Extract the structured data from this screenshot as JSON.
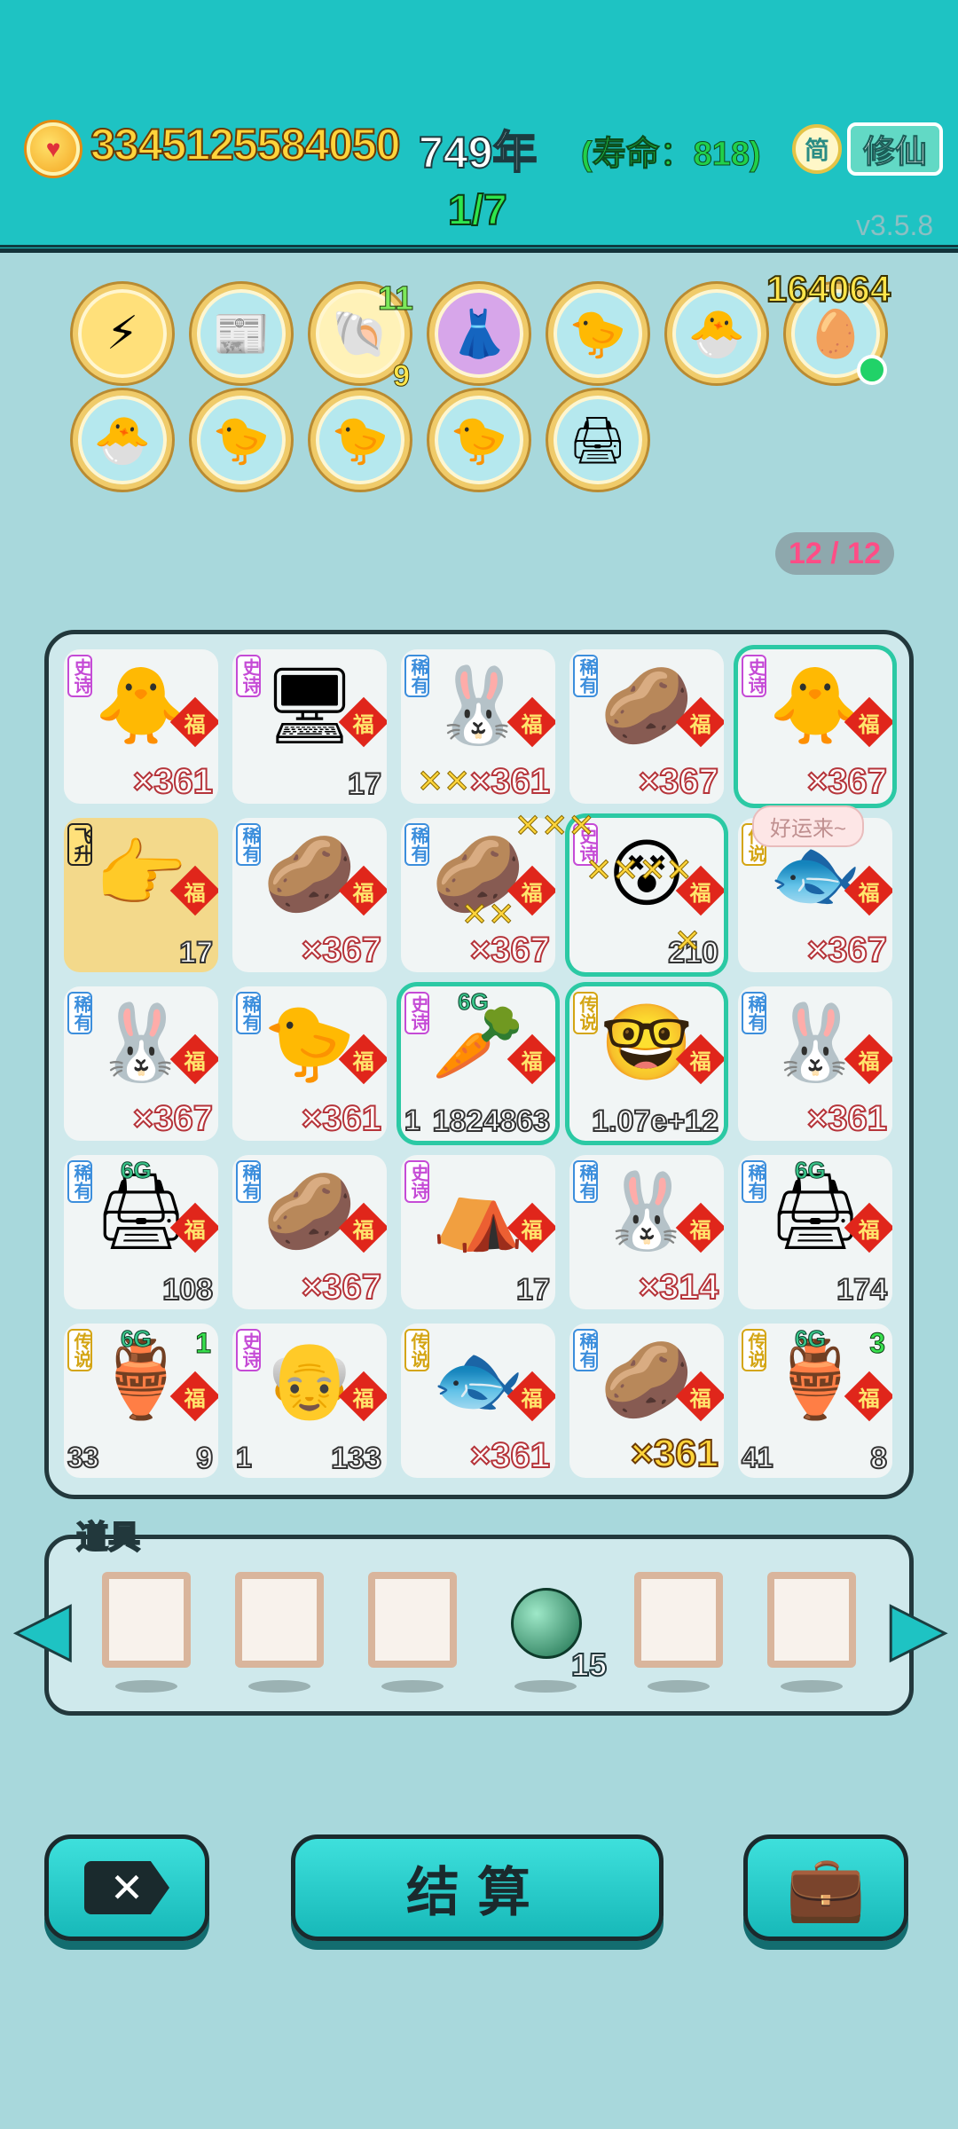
{
  "header": {
    "coin_icon": "heart-coin-icon",
    "coins": "3345125584050",
    "years": "749年",
    "lifespan": "(寿命：818)",
    "simp_label": "简",
    "xiuxian_label": "修仙",
    "stage": "1/7",
    "version": "v3.5.8"
  },
  "relics": {
    "row1": [
      {
        "icon": "lightning-icon",
        "glyph": "⚡"
      },
      {
        "icon": "time-magazine-icon",
        "glyph": "📰"
      },
      {
        "icon": "shell-icon",
        "glyph": "🐚",
        "top_count": "11",
        "bottom_count": "9"
      },
      {
        "icon": "pleated-skirt-icon",
        "glyph": "👗"
      },
      {
        "icon": "syringe-chick-icon",
        "glyph": "🐤"
      },
      {
        "icon": "chick-egg-icon",
        "glyph": "🐣"
      },
      {
        "icon": "egg-tray-icon",
        "glyph": "🥚"
      }
    ],
    "row2": [
      {
        "icon": "chick-egg-icon",
        "glyph": "🐣"
      },
      {
        "icon": "syringe-chick-icon",
        "glyph": "🐤"
      },
      {
        "icon": "syringe-chick-icon",
        "glyph": "🐤"
      },
      {
        "icon": "syringe-chick-icon",
        "glyph": "🐤"
      },
      {
        "icon": "printer-icon",
        "glyph": "🖨"
      }
    ],
    "tool_count": "164064",
    "slots": "12 / 12"
  },
  "board": {
    "fu": "福",
    "speech": "好运来~",
    "cells": [
      {
        "rarity": "史诗",
        "cls": "r-shishi",
        "glyph": "🐥",
        "value": "×361",
        "style": ""
      },
      {
        "rarity": "史诗",
        "cls": "r-shishi",
        "glyph": "🖥",
        "value": "17",
        "style": "plain"
      },
      {
        "rarity": "稀有",
        "cls": "r-xiyou",
        "glyph": "🐰",
        "value": "×361",
        "style": ""
      },
      {
        "rarity": "稀有",
        "cls": "r-xiyou",
        "glyph": "🥔",
        "value": "×367",
        "style": ""
      },
      {
        "rarity": "史诗",
        "cls": "r-shishi",
        "glyph": "🐥",
        "value": "×367",
        "style": "",
        "selected": true
      },
      {
        "rarity": "飞升",
        "cls": "r-feisheng",
        "glyph": "👉",
        "value": "17",
        "style": "plain",
        "flying": true
      },
      {
        "rarity": "稀有",
        "cls": "r-xiyou",
        "glyph": "🥔",
        "value": "×367",
        "style": ""
      },
      {
        "rarity": "稀有",
        "cls": "r-xiyou",
        "glyph": "🥔",
        "value": "×367",
        "style": ""
      },
      {
        "rarity": "史诗",
        "cls": "r-shishi",
        "glyph": "😵",
        "value": "210",
        "style": "plain",
        "selected": true
      },
      {
        "rarity": "传说",
        "cls": "r-chuanshuo",
        "glyph": "🐟",
        "value": "×367",
        "style": ""
      },
      {
        "rarity": "稀有",
        "cls": "r-xiyou",
        "glyph": "🐰",
        "value": "×367",
        "style": ""
      },
      {
        "rarity": "稀有",
        "cls": "r-xiyou",
        "glyph": "🐤",
        "value": "×361",
        "style": ""
      },
      {
        "rarity": "史诗",
        "cls": "r-shishi",
        "glyph": "🥕",
        "value": "1824863",
        "left": "1",
        "six_g": "6G",
        "style": "plain",
        "selected": true
      },
      {
        "rarity": "传说",
        "cls": "r-chuanshuo",
        "glyph": "🤓",
        "value": "1.07e+12",
        "style": "plain",
        "selected": true
      },
      {
        "rarity": "稀有",
        "cls": "r-xiyou",
        "glyph": "🐰",
        "value": "×361",
        "style": ""
      },
      {
        "rarity": "稀有",
        "cls": "r-xiyou",
        "glyph": "🖨",
        "value": "108",
        "six_g": "6G",
        "style": "plain"
      },
      {
        "rarity": "稀有",
        "cls": "r-xiyou",
        "glyph": "🥔",
        "value": "×367",
        "style": ""
      },
      {
        "rarity": "史诗",
        "cls": "r-shishi",
        "glyph": "⛺",
        "value": "17",
        "style": "plain"
      },
      {
        "rarity": "稀有",
        "cls": "r-xiyou",
        "glyph": "🐰",
        "value": "×314",
        "style": ""
      },
      {
        "rarity": "稀有",
        "cls": "r-xiyou",
        "glyph": "🖨",
        "value": "174",
        "six_g": "6G",
        "style": "plain"
      },
      {
        "rarity": "传说",
        "cls": "r-chuanshuo",
        "glyph": "🏺",
        "value": "9",
        "left": "33",
        "six_g": "6G",
        "corner": "1",
        "style": "plain"
      },
      {
        "rarity": "史诗",
        "cls": "r-shishi",
        "glyph": "👴",
        "value": "133",
        "left": "1",
        "style": "plain"
      },
      {
        "rarity": "传说",
        "cls": "r-chuanshuo",
        "glyph": "🐟",
        "value": "×361",
        "style": ""
      },
      {
        "rarity": "稀有",
        "cls": "r-xiyou",
        "glyph": "🥔",
        "value": "×361",
        "style": "gold"
      },
      {
        "rarity": "传说",
        "cls": "r-chuanshuo",
        "glyph": "🏺",
        "value": "8",
        "left": "41",
        "six_g": "6G",
        "corner": "3",
        "style": "plain"
      }
    ]
  },
  "items": {
    "title": "道具",
    "orb_count": "15",
    "orb_icon": "jade-orb-icon"
  },
  "buttons": {
    "close_label": "✕",
    "settle_label": "结算",
    "bag_icon": "briefcase-icon"
  },
  "colors": {
    "header_bg": "#1ec3c3",
    "page_bg": "#a8d8dc",
    "coin_text": "#ffd43b",
    "lifespan_text": "#21d04a",
    "stage_text": "#2ee64c"
  }
}
